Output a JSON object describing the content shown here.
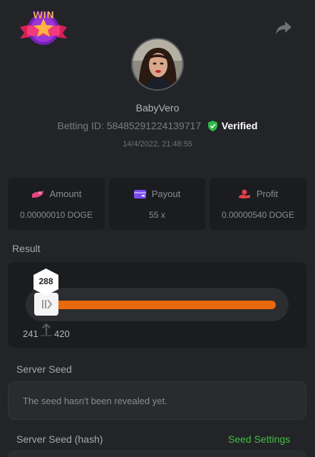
{
  "header": {
    "logo_text": "WIN",
    "share_icon": "share-icon"
  },
  "profile": {
    "username": "BabyVero",
    "betting_id_label": "Betting ID:",
    "betting_id": "58485291224139717",
    "verified_label": "Verified",
    "timestamp": "14/4/2022, 21:48:55"
  },
  "stats": [
    {
      "icon": "amount-icon",
      "label": "Amount",
      "value": "0.00000010 DOGE",
      "color": "#e0457b"
    },
    {
      "icon": "payout-icon",
      "label": "Payout",
      "value": "55 x",
      "color": "#7b4cf0"
    },
    {
      "icon": "profit-icon",
      "label": "Profit",
      "value": "0.00000540 DOGE",
      "color": "#e0404a"
    }
  ],
  "result": {
    "title": "Result",
    "value": "288",
    "range_low": "241",
    "range_high": "420",
    "fill_color": "#e8690b"
  },
  "server_seed": {
    "title": "Server Seed",
    "value": "The seed hasn't been revealed yet."
  },
  "server_seed_hash": {
    "title": "Server Seed (hash)",
    "link": "Seed Settings",
    "link_color": "#3fbf3f"
  }
}
